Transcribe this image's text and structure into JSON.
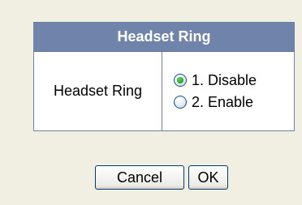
{
  "panel": {
    "title": "Headset Ring",
    "label": "Headset Ring",
    "options": [
      {
        "label": "1. Disable",
        "selected": true
      },
      {
        "label": "2. Enable",
        "selected": false
      }
    ]
  },
  "buttons": {
    "cancel": "Cancel",
    "ok": "OK"
  },
  "colors": {
    "background": "#f1efe2",
    "header": "#7084ab",
    "border": "#6e82a6"
  }
}
